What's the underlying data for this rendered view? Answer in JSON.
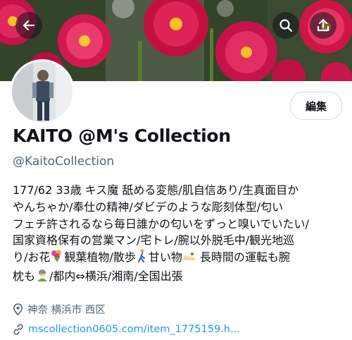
{
  "header": {
    "back_icon": "arrow-left-icon",
    "search_icon": "search-icon",
    "share_icon": "share-upload-icon"
  },
  "profile": {
    "display_name": "KAITO @M's Collection",
    "handle": "@KaitoCollection",
    "edit_label": "編集",
    "bio": {
      "part1": "177/62 33歳 キス魔 舐める変態/肌自信あり/生真面目か",
      "part2": "やんちゃか/奉仕の精神/ダビデのような彫刻体型/匂い",
      "part3": "フェチ許されるなら毎日誰かの匂いをずっと嗅いでいたい/",
      "part4": "国家資格保有の営業マン/宅トレ/腕以外脱毛中/観光地巡",
      "part5a": "り/お花",
      "part5b": "観葉植物/散歩",
      "part5c": "甘い物",
      "part5d": " 長時間の運転も腕",
      "part6a": "枕も",
      "part6b": "/都内⇔横浜/湘南/全国出張"
    },
    "location": "神奈 横浜市 西区",
    "url": "mscollection0605.com/item_1775159.h..."
  },
  "colors": {
    "link": "#1d9bf0",
    "secondary_text": "#536471",
    "border": "#cfd9de"
  }
}
